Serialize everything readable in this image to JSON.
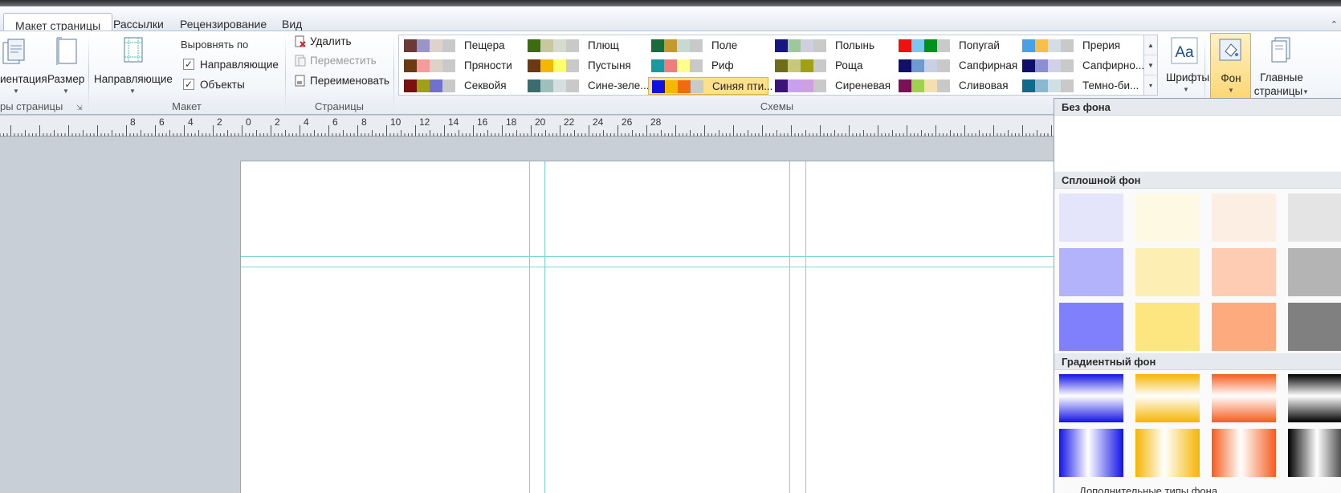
{
  "tabs": [
    "Макет страницы",
    "Рассылки",
    "Рецензирование",
    "Вид"
  ],
  "ribbon": {
    "orientation_label": "иентация",
    "size_label": "Размер",
    "page_setup_group": "ры страницы",
    "guides_label": "Направляющие",
    "align_label": "Выровнять по",
    "align_guides": "Направляющие",
    "align_objects": "Объекты",
    "layout_group": "Макет",
    "delete_label": "Удалить",
    "move_label": "Переместить",
    "rename_label": "Переименовать",
    "pages_group": "Страницы",
    "schemes_group": "Схемы",
    "fonts_label": "Шрифты",
    "background_label": "Фон",
    "master_pages_label1": "Главные",
    "master_pages_label2": "страницы"
  },
  "schemes": [
    {
      "name": "Пещера",
      "colors": [
        "#6b3a37",
        "#9b94c9",
        "#ddd2cc",
        "#c9c9c9"
      ]
    },
    {
      "name": "Плющ",
      "colors": [
        "#3c6b10",
        "#c8c8a0",
        "#d6dccd",
        "#c9c9c9"
      ]
    },
    {
      "name": "Поле",
      "colors": [
        "#1b6b3a",
        "#c49a2c",
        "#c7d9d0",
        "#c9c9c9"
      ]
    },
    {
      "name": "Полынь",
      "colors": [
        "#16167f",
        "#9ec79b",
        "#d0cfe0",
        "#c9c9c9"
      ]
    },
    {
      "name": "Попугай",
      "colors": [
        "#f01010",
        "#78c8f0",
        "#00901c",
        "#c9c9c9"
      ]
    },
    {
      "name": "Прерия",
      "colors": [
        "#4aa0e8",
        "#f5c04a",
        "#d4dce6",
        "#c9c9c9"
      ]
    },
    {
      "name": "Пряности",
      "colors": [
        "#6b3a12",
        "#f59b9b",
        "#ddd2c6",
        "#c9c9c9"
      ]
    },
    {
      "name": "Пустыня",
      "colors": [
        "#6b3a12",
        "#f5b800",
        "#ffff6e",
        "#c9c9c9"
      ]
    },
    {
      "name": "Риф",
      "colors": [
        "#1a9aa0",
        "#f07d7d",
        "#ffff8a",
        "#c9c9c9"
      ]
    },
    {
      "name": "Роща",
      "colors": [
        "#6e6e1a",
        "#c8c87a",
        "#a0a014",
        "#c9c9c9"
      ]
    },
    {
      "name": "Сапфирная",
      "colors": [
        "#10106b",
        "#6e9acf",
        "#c8d0e6",
        "#c9c9c9"
      ]
    },
    {
      "name": "Сапфирно...",
      "colors": [
        "#10106b",
        "#8e8ed2",
        "#d0d0e8",
        "#c9c9c9"
      ]
    },
    {
      "name": "Секвойя",
      "colors": [
        "#7a1010",
        "#a0a018",
        "#7070d0",
        "#c9c9c9"
      ]
    },
    {
      "name": "Сине-зеле...",
      "colors": [
        "#3a6e6e",
        "#a0c0c0",
        "#d6dede",
        "#c9c9c9"
      ]
    },
    {
      "name": "Синяя пти...",
      "colors": [
        "#1010e0",
        "#f5b800",
        "#f06a10",
        "#c9c9c9"
      ]
    },
    {
      "name": "Сиреневая",
      "colors": [
        "#3a1478",
        "#c8a0f0",
        "#d0a0e0",
        "#c9c9c9"
      ]
    },
    {
      "name": "Сливовая",
      "colors": [
        "#7a1058",
        "#a0d050",
        "#f5deb0",
        "#c9c9c9"
      ]
    },
    {
      "name": "Темно-би...",
      "colors": [
        "#106a8a",
        "#8ab8d0",
        "#d0dee6",
        "#c9c9c9"
      ]
    }
  ],
  "selected_scheme": "Синяя пти...",
  "ruler_labels": [
    "8",
    "6",
    "4",
    "2",
    "0",
    "2",
    "4",
    "6",
    "8",
    "10",
    "12",
    "14",
    "16",
    "18",
    "20",
    "22",
    "24",
    "26",
    "28"
  ],
  "panel": {
    "no_background": "Без фона",
    "solid_background": "Сплошной фон",
    "gradient_background": "Градиентный фон",
    "more_types": "Дополнительные типы фона...",
    "solid_colors": [
      [
        "#e4e4fa",
        "#fdf9e3",
        "#fdeee4",
        "#e4e4e4"
      ],
      [
        "#b3b3fb",
        "#fdefb3",
        "#fdccb2",
        "#b4b4b4"
      ],
      [
        "#8080fd",
        "#fde580",
        "#fdaa7f",
        "#808080"
      ]
    ],
    "gradient_colors": [
      "#1212e6",
      "#f5b500",
      "#f55c1e",
      "#000000"
    ]
  }
}
